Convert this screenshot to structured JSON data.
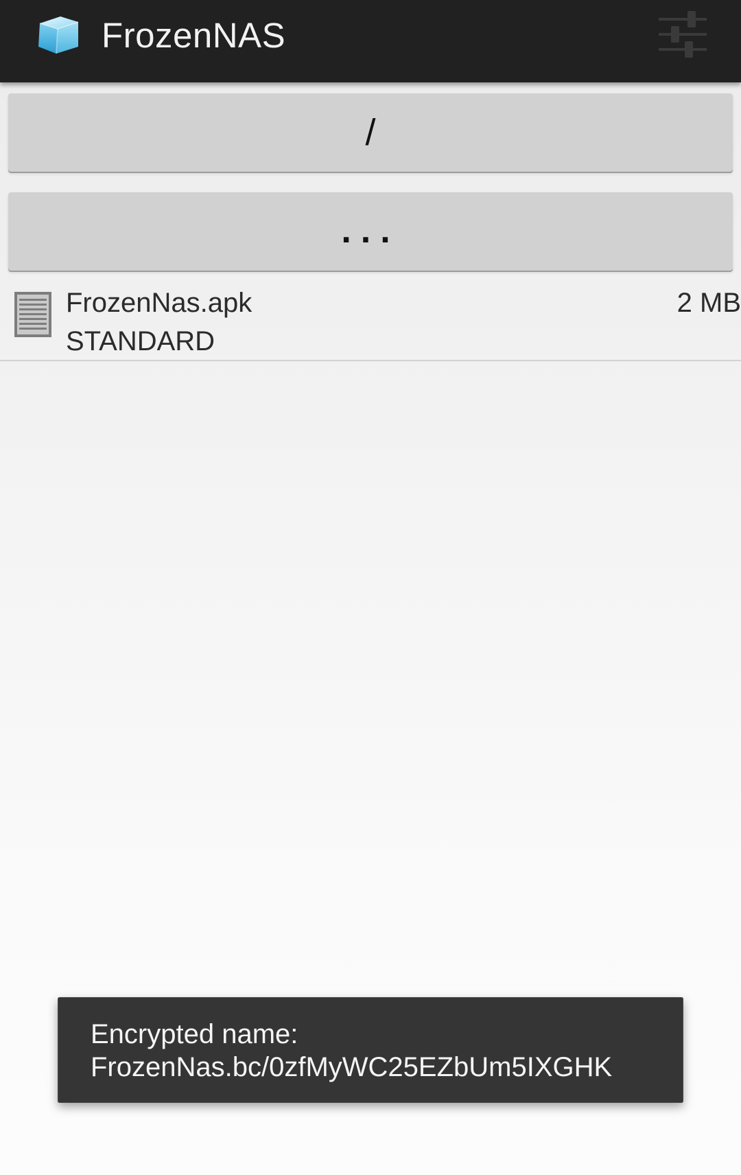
{
  "action_bar": {
    "app_icon": "ice-cube-icon",
    "title": "FrozenNAS",
    "settings_icon": "sliders-icon"
  },
  "navigation": {
    "root_label": "/",
    "parent_label": "...",
    "parent_icon": "more-horizontal-icon"
  },
  "files": [
    {
      "icon": "document-icon",
      "name": "FrozenNas.apk",
      "type": "STANDARD",
      "size": "2 MB"
    }
  ],
  "toast": {
    "line1": "Encrypted name:",
    "line2": "FrozenNas.bc/0zfMyWC25EZbUm5IXGHK"
  },
  "colors": {
    "action_bar": "#212121",
    "button": "#d1d1d1",
    "toast": "#353535"
  }
}
